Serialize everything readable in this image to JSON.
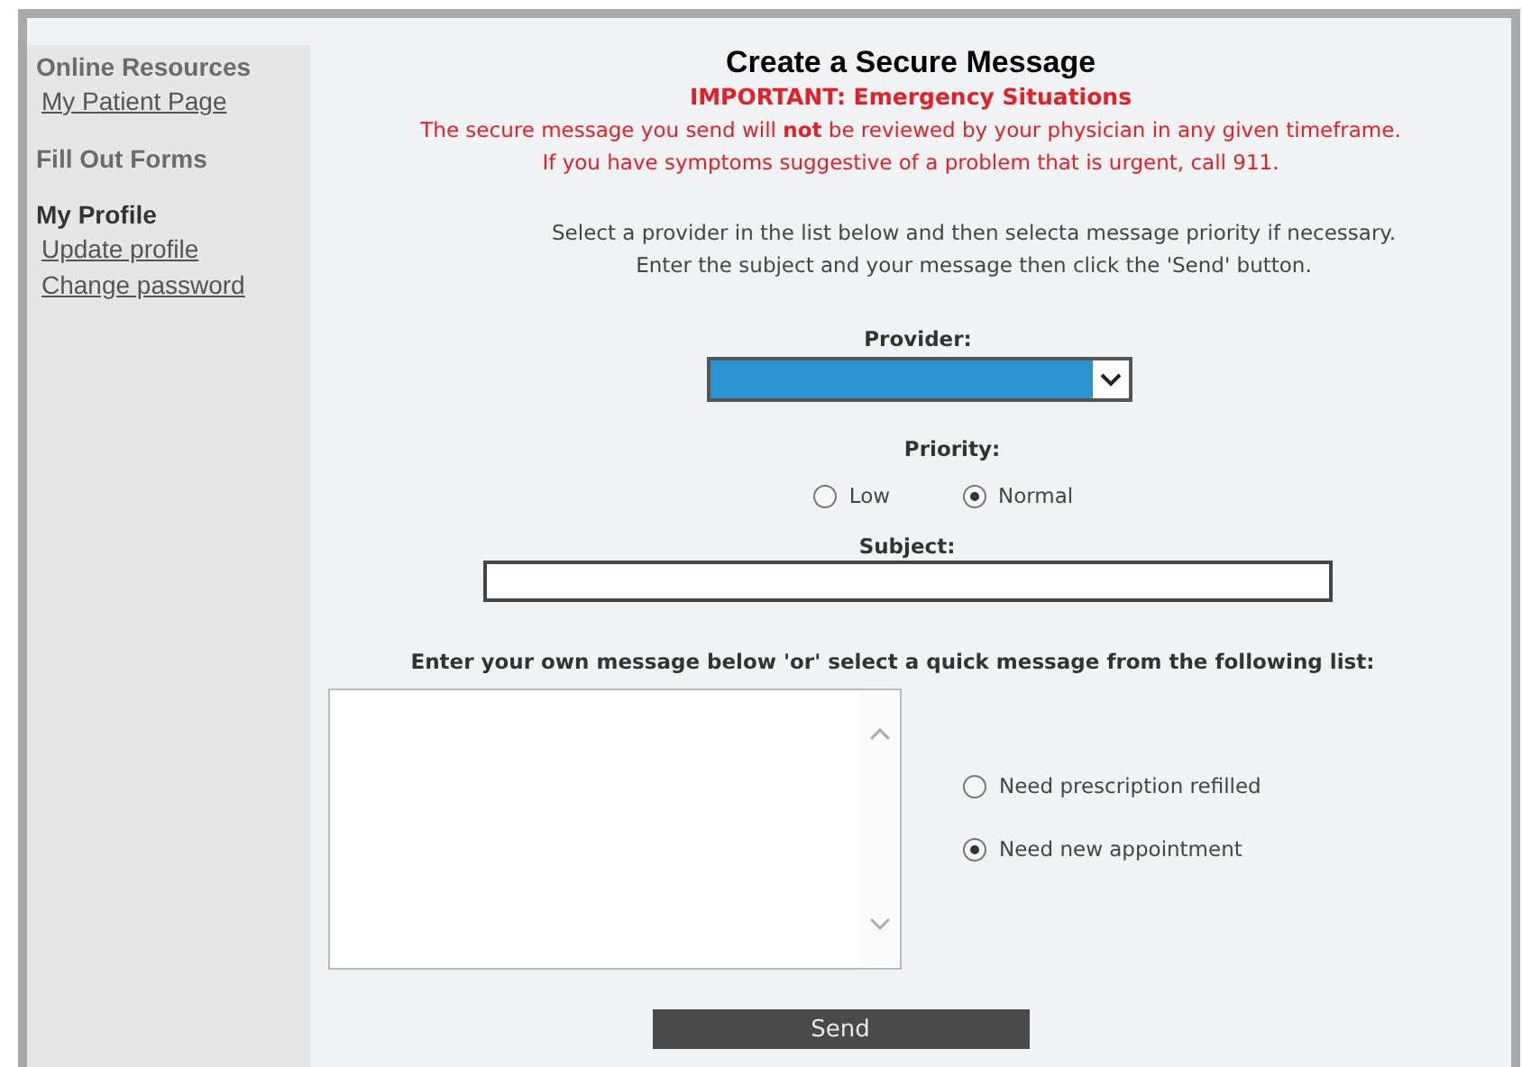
{
  "sidebar": {
    "groups": [
      {
        "heading": "Online Resources",
        "current": false,
        "links": [
          "My Patient Page"
        ]
      },
      {
        "heading": "Fill Out Forms",
        "current": false
      },
      {
        "heading": "My Profile",
        "current": true,
        "links": [
          "Update profile",
          "Change password"
        ]
      }
    ]
  },
  "main": {
    "title": "Create a Secure Message",
    "alert_heading": "IMPORTANT: Emergency Situations",
    "alert_lines": [
      "The secure message you send will **not** be reviewed by your physician in any given timeframe.",
      "If you have symptoms suggestive of a problem that is urgent, call 911."
    ],
    "instructions": [
      "Select a provider in the list below and then selecta message priority if necessary.",
      "Enter the subject and your message then click the 'Send' button."
    ],
    "provider": {
      "label": "Provider:"
    },
    "priority": {
      "label": "Priority:",
      "options": [
        {
          "label": "Low",
          "selected": false
        },
        {
          "label": "Normal",
          "selected": true
        }
      ]
    },
    "subject": {
      "label": "Subject:"
    },
    "message": {
      "label": "Enter your own message below 'or' select a quick message from the following list:"
    },
    "quick_messages": [
      {
        "label": "Need prescription refilled",
        "selected": false
      },
      {
        "label": "Need new appointment",
        "selected": true
      }
    ],
    "send_button": "Send"
  }
}
